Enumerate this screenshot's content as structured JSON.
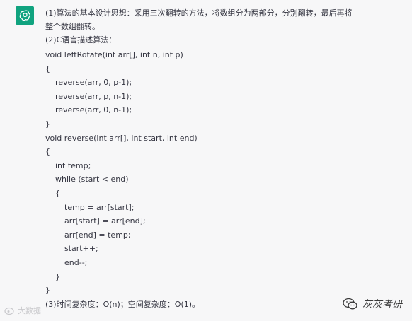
{
  "message": {
    "intro_lines": [
      "(1)算法的基本设计思想：采用三次翻转的方法，将数组分为两部分，分别翻转，最后再将",
      "整个数组翻转。",
      "(2)C语言描述算法："
    ],
    "code_lines": [
      {
        "indent": 0,
        "text": "void leftRotate(int arr[], int n, int p)"
      },
      {
        "indent": 0,
        "text": "{"
      },
      {
        "indent": 1,
        "text": "reverse(arr, 0, p-1);"
      },
      {
        "indent": 1,
        "text": "reverse(arr, p, n-1);"
      },
      {
        "indent": 1,
        "text": "reverse(arr, 0, n-1);"
      },
      {
        "indent": 0,
        "text": "}"
      },
      {
        "indent": 0,
        "text": "void reverse(int arr[], int start, int end)"
      },
      {
        "indent": 0,
        "text": "{"
      },
      {
        "indent": 1,
        "text": "int temp;"
      },
      {
        "indent": 1,
        "text": "while (start < end)"
      },
      {
        "indent": 1,
        "text": "{"
      },
      {
        "indent": 2,
        "text": "temp = arr[start];"
      },
      {
        "indent": 2,
        "text": "arr[start] = arr[end];"
      },
      {
        "indent": 2,
        "text": "arr[end] = temp;"
      },
      {
        "indent": 2,
        "text": "start++;"
      },
      {
        "indent": 2,
        "text": "end--;"
      },
      {
        "indent": 1,
        "text": "}"
      },
      {
        "indent": 0,
        "text": "}"
      }
    ],
    "complexity_line": "(3)时间复杂度：O(n)；空间复杂度：O(1)。"
  },
  "avatar": {
    "icon": "chatgpt-logo-icon",
    "color": "#10a37f"
  },
  "watermarks": {
    "left_text": "大数据",
    "right_text": "灰灰考研",
    "right_icon": "wechat-icon"
  }
}
